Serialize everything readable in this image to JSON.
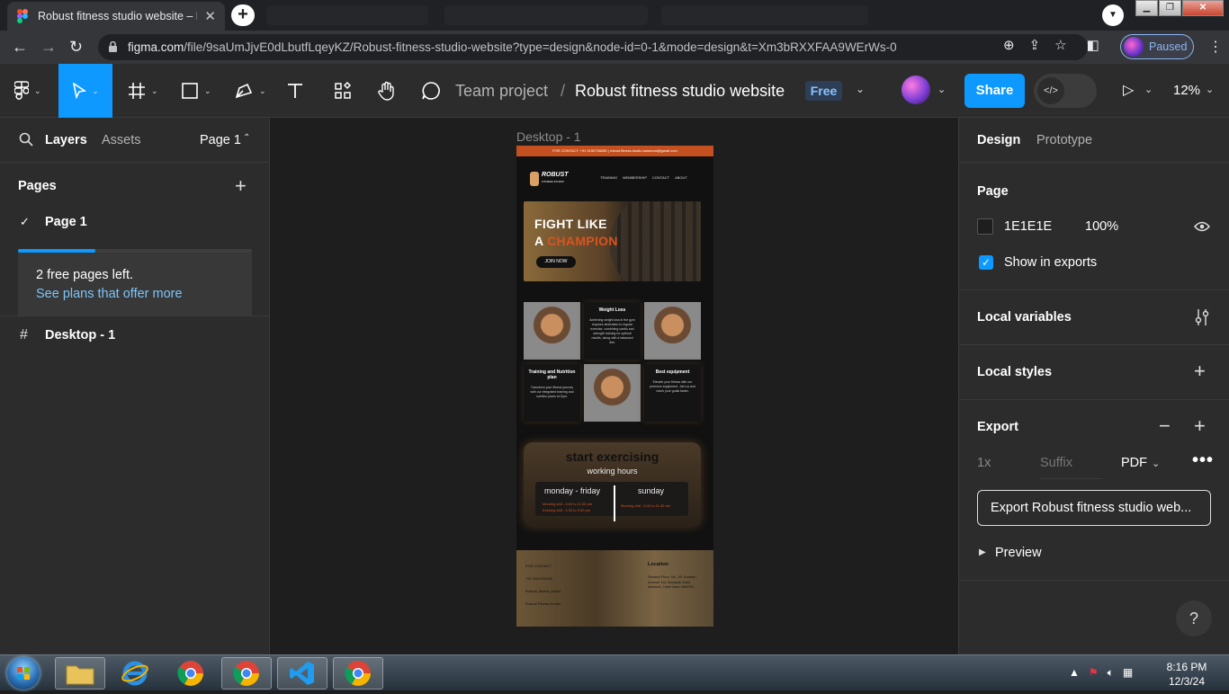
{
  "browser": {
    "tab_title": "Robust fitness studio website – Figma",
    "url_domain": "figma.com",
    "url_path": "/file/9saUmJjvE0dLbutfLqeyKZ/Robust-fitness-studio-website?type=design&node-id=0-1&mode=design&t=Xm3bRXXFAA9WErWs-0",
    "profile_status": "Paused"
  },
  "toolbar": {
    "team": "Team project",
    "separator": "/",
    "file_name": "Robust fitness studio website",
    "plan_badge": "Free",
    "share_label": "Share",
    "zoom": "12%"
  },
  "left_panel": {
    "tab_layers": "Layers",
    "tab_assets": "Assets",
    "page_selector": "Page 1",
    "pages_heading": "Pages",
    "pages": [
      "Page 1"
    ],
    "free_pages_text": "2 free pages left.",
    "plans_link": "See plans that offer more",
    "free_pages_used_fraction": 0.33,
    "layers": [
      "Desktop - 1"
    ]
  },
  "canvas": {
    "frame_label": "Desktop - 1",
    "site": {
      "topbar": "FOR CONTACT: +91 9150758285 | robust.fitness.studio.sandoval@gmail.com",
      "logo": "ROBUST",
      "logo_sub": "FITNESS STUDIO",
      "nav": [
        "TRAINING",
        "MEMBERSHIP",
        "CONTACT",
        "ABOUT"
      ],
      "hero_line1": "FIGHT LIKE",
      "hero_line2_a": "A",
      "hero_line2_b": "CHAMPION",
      "hero_button": "JOIN NOW",
      "cards": [
        {
          "title": "Weight Loss",
          "body": "Achieving weight loss in the gym requires dedication to regular exercise, combining cardio and strength training for optimal results, along with a balanced diet."
        },
        {
          "title": "Training and Nutrition plan",
          "body": "Transform your fitness journey with our integrated training and nutrition plans at Gym."
        },
        {
          "title": "Best equipment",
          "body": "Elevate your fitness with our premium equipment. Join us and reach your goals faster."
        }
      ],
      "hours_title": "start exercising",
      "hours_sub": "working hours",
      "weekday_label": "monday - friday",
      "weekday_morning": "Morning shif - 5.00 to 11.00 am",
      "weekday_evening": "Evening shif - 4.30 to 9.30 pm",
      "sunday_label": "sunday",
      "sunday_morning": "Morning shif - 5.00 to 11.00 am",
      "footer_contact_heading": "FOR CONTACT",
      "footer_contacts": [
        "+91 9150758285",
        "Robust_fitness_studio",
        "Robust Fitness Studio"
      ],
      "location_heading": "Location",
      "location_address": "Second Floor, No. 18, Kannan Avenue 1st, Madipak Main, Madurai, Tamil Nadu 600091"
    }
  },
  "right_panel": {
    "tab_design": "Design",
    "tab_prototype": "Prototype",
    "page_heading": "Page",
    "page_color_hex": "1E1E1E",
    "page_opacity": "100%",
    "show_in_exports": "Show in exports",
    "local_variables": "Local variables",
    "local_styles": "Local styles",
    "export_heading": "Export",
    "export_scale": "1x",
    "export_suffix_placeholder": "Suffix",
    "export_format": "PDF",
    "export_button": "Export Robust fitness studio web...",
    "preview": "Preview",
    "help": "?"
  },
  "taskbar": {
    "time": "8:16 PM",
    "date": "12/3/24"
  },
  "colors": {
    "figma_blue": "#0d99ff",
    "accent_orange": "#d9541e",
    "canvas_bg": "#1e1e1e",
    "panel_bg": "#2c2c2c"
  }
}
